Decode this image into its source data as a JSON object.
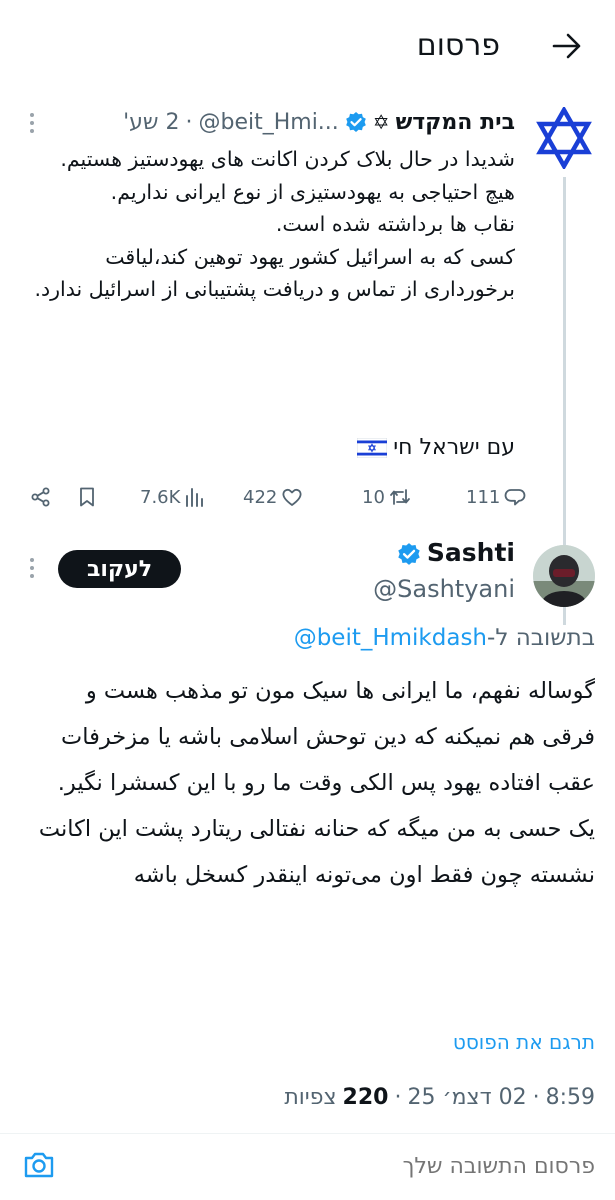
{
  "header": {
    "title": "פרסום",
    "back_icon": "arrow-right-icon"
  },
  "parent_post": {
    "display_name": "בית המקדש",
    "name_emoji": "✡",
    "handle": "@beit_Hmi...",
    "time": "2 שע'",
    "separator": "·",
    "text": "شدیدا در حال بلاک کردن اکانت های یهودستیز هستیم.\nهیچ احتیاجی به یهودستیزی از نوع ایرانی نداریم.\nنقاب ها برداشته شده است.\nکسی که به اسرائیل کشور یهود توهین کند،لیاقت برخورداری از تماس و دریافت پشتیبانی از اسرائیل ندارد.",
    "closing_line": "עם ישראל חי",
    "stats": {
      "replies": "111",
      "reposts": "10",
      "likes": "422",
      "views": "7.6K"
    }
  },
  "reply_post": {
    "display_name": "Sashti",
    "handle": "@Sashtyani",
    "follow_label": "לעקוב",
    "replying_prefix": "בתשובה ל-",
    "replying_to": "@beit_Hmikdash",
    "text": "گوساله نفهم، ما ایرانی ها سیک مون تو مذهب هست و فرقی هم نمیکنه که دین توحش اسلامی باشه یا مزخرفات عقب افتاده یهود پس الکی وقت ما رو با این کسشرا نگیر. یک حسی به من میگه که حنانه نفتالی ریتارد پشت این اکانت نشسته چون فقط اون می‌تونه اینقدر کسخل باشه",
    "translate_label": "תרגם את הפוסט",
    "time": "8:59",
    "date": "02 דצמ׳ 25",
    "views_count": "220",
    "views_label": "צפיות",
    "separator": "·"
  },
  "compose": {
    "placeholder": "פרסום התשובה שלך"
  },
  "colors": {
    "accent": "#1d9bf0",
    "text": "#0f1419",
    "muted": "#536471",
    "star_of_david": "#1a3fd6"
  }
}
